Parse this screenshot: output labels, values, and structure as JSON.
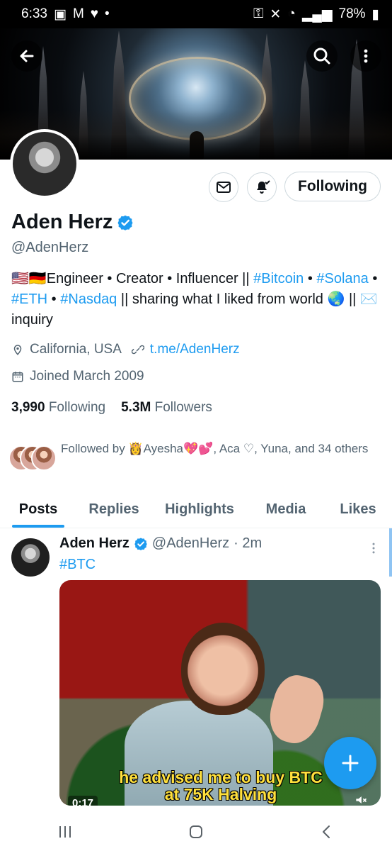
{
  "status_bar": {
    "time": "6:33",
    "battery": "78%"
  },
  "profile": {
    "name": "Aden Herz",
    "handle": "@AdenHerz",
    "bio_parts": {
      "part1": "🇺🇸🇩🇪Engineer • Creator • Influencer || ",
      "tag1": "#Bitcoin",
      "sep1": " • ",
      "tag2": "#Solana",
      "sep2": " • ",
      "tag3": "#ETH",
      "sep3": " • ",
      "tag4": "#Nasdaq",
      "part2": " || sharing what I liked from world 🌏 || ✉️ inquiry"
    },
    "location": "California, USA",
    "website": "t.me/AdenHerz",
    "joined": "Joined March 2009",
    "following_count": "3,990",
    "following_label": "Following",
    "followers_count": "5.3M",
    "followers_label": "Followers",
    "followed_by_text": "Followed by 👸Ayesha💖💕, Aca ♡, Yuna, and 34 others",
    "following_button_label": "Following"
  },
  "tabs": [
    {
      "label": "Posts"
    },
    {
      "label": "Replies"
    },
    {
      "label": "Highlights"
    },
    {
      "label": "Media"
    },
    {
      "label": "Likes"
    }
  ],
  "post": {
    "author_name": "Aden Herz",
    "author_handle": "@AdenHerz",
    "time": "· 2m",
    "hashtag": "#BTC",
    "video_caption_line1": "he advised me to buy BTC",
    "video_caption_line2": "at 75K Halving",
    "video_time": "0:17"
  },
  "colors": {
    "accent": "#1d9bf0",
    "text_secondary": "#536471",
    "border": "#cfd9de"
  },
  "icons": {
    "back": "back-arrow-icon",
    "search": "search-icon",
    "more": "more-vertical-icon",
    "message": "mail-icon",
    "notifications": "bell-icon",
    "location": "location-icon",
    "link": "link-icon",
    "calendar": "calendar-icon",
    "fab": "plus-icon"
  }
}
